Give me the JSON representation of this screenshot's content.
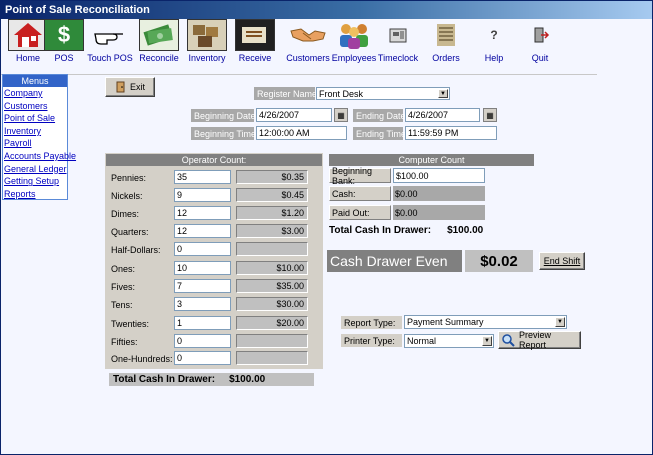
{
  "window": {
    "title": "Point of Sale Reconciliation"
  },
  "toolbar": {
    "buttons": [
      {
        "label": "Home",
        "icon": "house-icon"
      },
      {
        "label": "POS",
        "icon": "dollar-icon"
      },
      {
        "label": "Touch  POS",
        "icon": "hand-pointer-icon"
      },
      {
        "label": "Reconcile",
        "icon": "money-icon"
      },
      {
        "label": "Inventory",
        "icon": "boxes-icon"
      },
      {
        "label": "Receive",
        "icon": "receive-icon"
      },
      {
        "label": "Customers",
        "icon": "handshake-icon"
      },
      {
        "label": "Employees",
        "icon": "people-icon"
      },
      {
        "label": "Timeclock",
        "icon": "clock-icon"
      },
      {
        "label": "Orders",
        "icon": "orders-icon"
      },
      {
        "label": "Help",
        "icon": "help-icon"
      },
      {
        "label": "Quit",
        "icon": "quit-icon"
      }
    ]
  },
  "sidebar": {
    "header": "Menus",
    "items": [
      {
        "label": "Company"
      },
      {
        "label": "Customers"
      },
      {
        "label": "Point of Sale "
      },
      {
        "label": "Inventory "
      },
      {
        "label": "Payroll "
      },
      {
        "label": "Accounts Payable"
      },
      {
        "label": "General Ledger "
      },
      {
        "label": "Getting Setup"
      },
      {
        "label": "Reports"
      }
    ]
  },
  "exit_button": {
    "label": "Exit"
  },
  "filters": {
    "register_label": "Register Name:",
    "register_value": "Front Desk",
    "begin_date_label": "Beginning Date:",
    "begin_date_value": "4/26/2007",
    "end_date_label": "Ending Date:",
    "end_date_value": "4/26/2007",
    "begin_time_label": "Beginning Time:",
    "begin_time_value": "12:00:00 AM",
    "end_time_label": "Ending Time:",
    "end_time_value": "11:59:59 PM"
  },
  "operator_count": {
    "header": "Operator Count:",
    "rows": [
      {
        "label": "Pennies:",
        "count": "35",
        "total": "$0.35"
      },
      {
        "label": "Nickels:",
        "count": "9",
        "total": "$0.45"
      },
      {
        "label": "Dimes:",
        "count": "12",
        "total": "$1.20"
      },
      {
        "label": "Quarters:",
        "count": "12",
        "total": "$3.00"
      },
      {
        "label": "Half-Dollars:",
        "count": "0",
        "total": ""
      },
      {
        "label": "Ones:",
        "count": "10",
        "total": "$10.00"
      },
      {
        "label": "Fives:",
        "count": "7",
        "total": "$35.00"
      },
      {
        "label": "Tens:",
        "count": "3",
        "total": "$30.00"
      },
      {
        "label": "Twenties:",
        "count": "1",
        "total": "$20.00"
      },
      {
        "label": "Fifties:",
        "count": "0",
        "total": ""
      },
      {
        "label": "One-Hundreds:",
        "count": "0",
        "total": ""
      }
    ],
    "total_label": "Total Cash In Drawer:",
    "total_value": "$100.00"
  },
  "computer_count": {
    "header": "Computer Count",
    "beginning_bank_label": "Beginning Bank:",
    "beginning_bank_value": "$100.00",
    "cash_label": "Cash:",
    "cash_value": "$0.00",
    "paid_out_label": "Paid Out:",
    "paid_out_value": "$0.00",
    "total_label": "Total Cash In Drawer:",
    "total_value": "$100.00"
  },
  "drawer": {
    "status": "Cash Drawer Even",
    "amount": "$0.02",
    "end_shift_label": "End Shift"
  },
  "report": {
    "type_label": "Report Type:",
    "type_value": "Payment Summary",
    "printer_label": "Printer Type:",
    "printer_value": "Normal",
    "preview_label": "Preview Report"
  }
}
